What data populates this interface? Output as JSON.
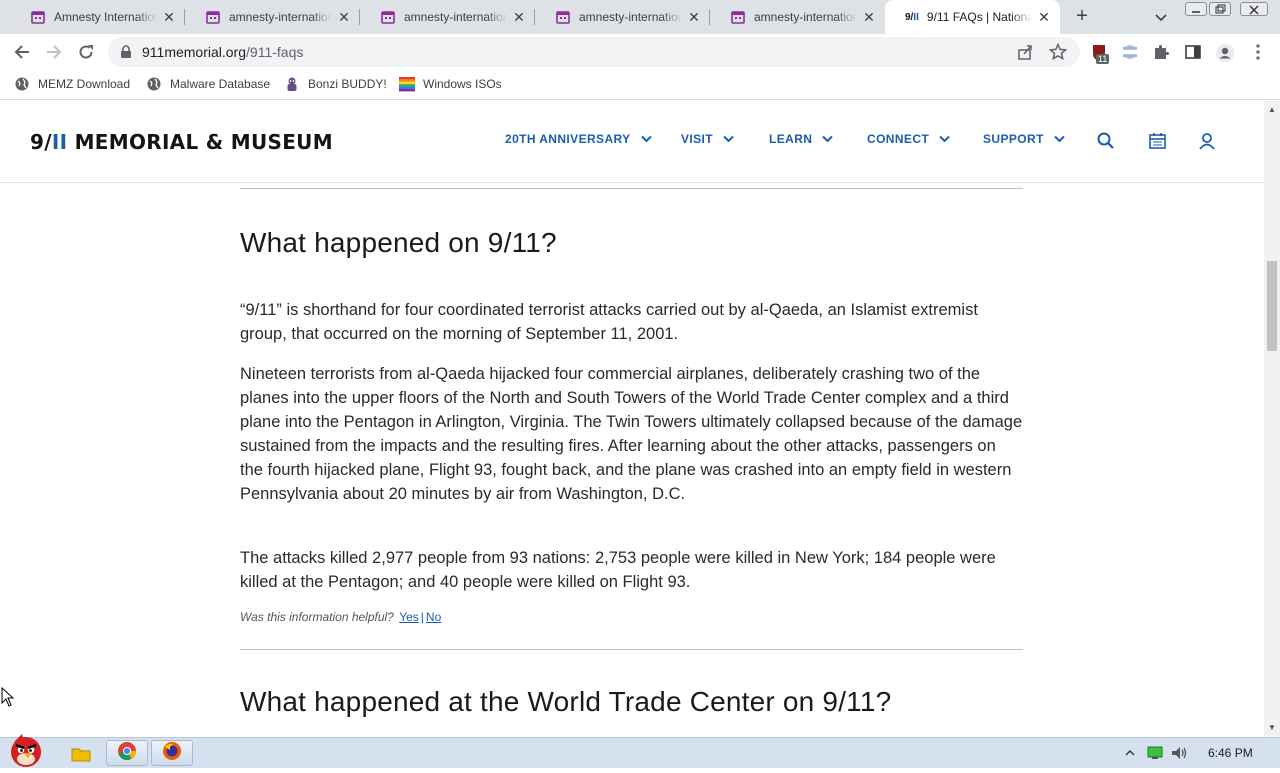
{
  "browser": {
    "tabs": [
      {
        "title": "Amnesty International",
        "active": false
      },
      {
        "title": "amnesty-international",
        "active": false
      },
      {
        "title": "amnesty-international",
        "active": false
      },
      {
        "title": "amnesty-international",
        "active": false
      },
      {
        "title": "amnesty-international",
        "active": false
      },
      {
        "title": "9/11 FAQs | National",
        "active": true
      }
    ],
    "url_domain": "911memorial.org",
    "url_path": "/911-faqs",
    "extension_badge": "11",
    "bookmarks": [
      "MEMZ Download",
      "Malware Database",
      "Bonzi BUDDY!",
      "Windows ISOs"
    ]
  },
  "site": {
    "logo_prefix": "9/",
    "logo_bars": "II",
    "logo_rest": " MEMORIAL & MUSEUM",
    "nav": [
      "20TH ANNIVERSARY",
      "VISIT",
      "LEARN",
      "CONNECT",
      "SUPPORT"
    ],
    "icons": [
      "search-icon",
      "calendar-icon",
      "user-icon"
    ],
    "brand_color": "#1a5db0"
  },
  "faq": {
    "q1_title": "What happened on 9/11?",
    "q1_paragraphs": [
      "“9/11” is shorthand for four coordinated terrorist attacks carried out by al-Qaeda, an Islamist extremist group, that occurred on the morning of September 11, 2001.",
      "Nineteen terrorists from al-Qaeda hijacked four commercial airplanes, deliberately crashing two of the planes into the upper floors of the North and South Towers of the World Trade Center complex and a third plane into the Pentagon in Arlington, Virginia. The Twin Towers ultimately collapsed because of the damage sustained from the impacts and the resulting fires. After learning about the other attacks, passengers on the fourth hijacked plane, Flight 93, fought back, and the plane was crashed into an empty field in western Pennsylvania about 20 minutes by air from Washington, D.C.",
      "The attacks killed 2,977 people from 93 nations: 2,753 people were killed in New York; 184 people were killed at the Pentagon; and 40 people were killed on Flight 93."
    ],
    "helpful_prompt": "Was this information helpful?",
    "helpful_yes": "Yes",
    "helpful_separator": "|",
    "helpful_no": "No",
    "q2_title": "What happened at the World Trade Center on 9/11?"
  },
  "taskbar": {
    "clock": "6:46 PM"
  }
}
